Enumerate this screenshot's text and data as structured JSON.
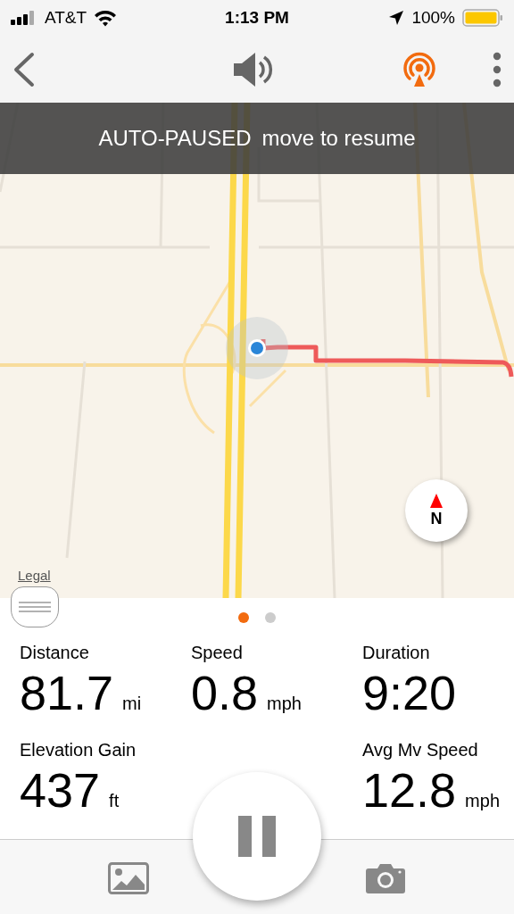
{
  "status_bar": {
    "carrier": "AT&T",
    "time": "1:13 PM",
    "battery": "100%"
  },
  "toolbar": {
    "live_tracking_on": true
  },
  "banner": {
    "title": "AUTO-PAUSED",
    "message": "move to resume"
  },
  "map": {
    "compass": "N",
    "legal": "Legal"
  },
  "pages": [
    {
      "selected": true
    },
    {
      "selected": false
    }
  ],
  "stats": [
    {
      "cells": [
        {
          "label": "Distance",
          "value": "81.7",
          "unit": "mi"
        },
        {
          "label": "Speed",
          "value": "0.8",
          "unit": "mph"
        },
        {
          "label": "Duration",
          "value": "9:20"
        }
      ]
    },
    {
      "cells": [
        {
          "label": "Elevation Gain",
          "value": "437",
          "unit": "ft"
        },
        {
          "label": "Avg Mv Speed",
          "value": "12.8",
          "unit": "mph"
        }
      ]
    }
  ]
}
